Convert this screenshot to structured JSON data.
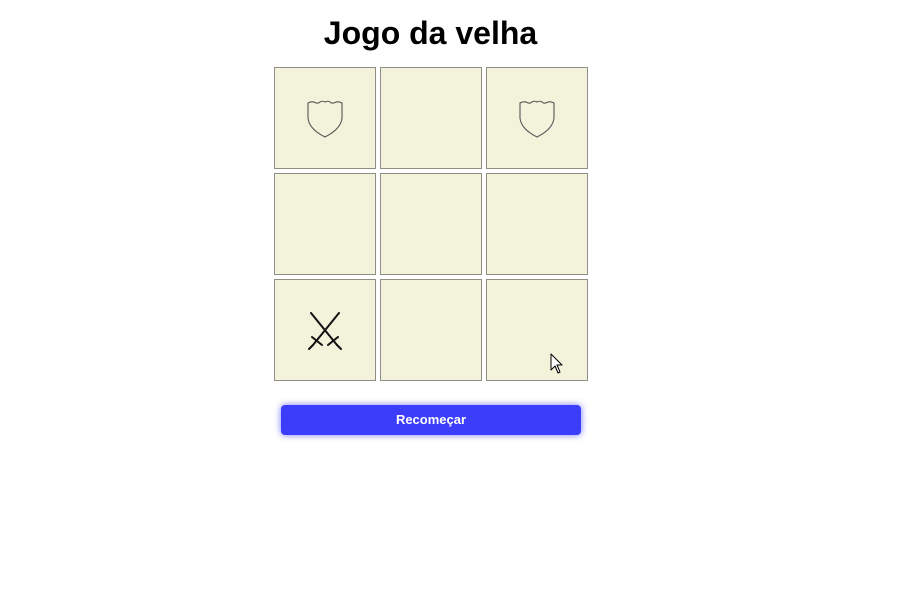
{
  "game": {
    "title": "Jogo da velha",
    "board": [
      {
        "row": 1,
        "col": 1,
        "mark": "shield-icon"
      },
      {
        "row": 1,
        "col": 2,
        "mark": ""
      },
      {
        "row": 1,
        "col": 3,
        "mark": "shield-icon"
      },
      {
        "row": 2,
        "col": 1,
        "mark": ""
      },
      {
        "row": 2,
        "col": 2,
        "mark": ""
      },
      {
        "row": 2,
        "col": 3,
        "mark": ""
      },
      {
        "row": 3,
        "col": 1,
        "mark": "crossed-swords-icon"
      },
      {
        "row": 3,
        "col": 2,
        "mark": ""
      },
      {
        "row": 3,
        "col": 3,
        "mark": ""
      }
    ],
    "restart_label": "Recomeçar"
  },
  "colors": {
    "cell_background": "#f3f3dc",
    "cell_border": "#8f8f86",
    "button_background": "#3c3cfb",
    "button_text": "#ffffff"
  }
}
